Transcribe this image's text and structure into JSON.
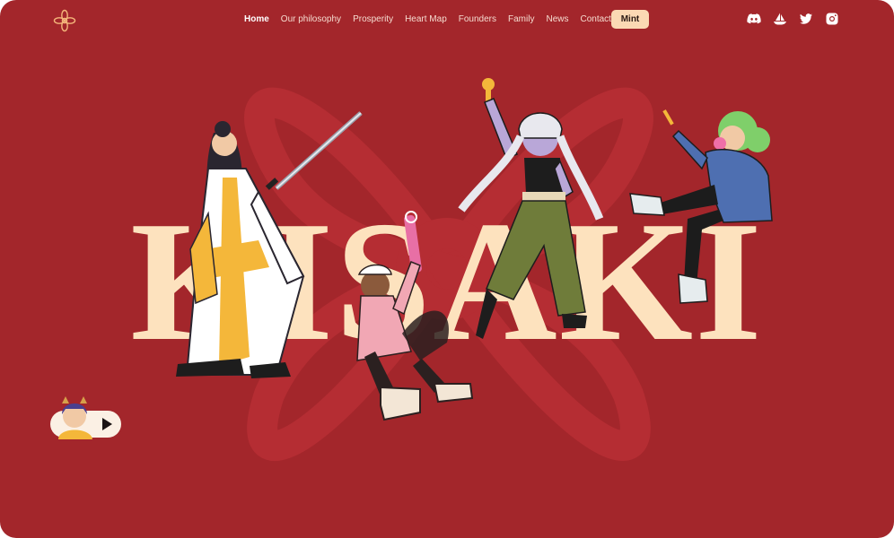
{
  "theme": {
    "background": "#a3262b",
    "watermark": "#b52d33",
    "title_color": "#fde2be",
    "mint_bg": "#fbd9b4",
    "icon_color": "#ffffff"
  },
  "brand": {
    "logo_icon": "flower-knot-logo-icon",
    "hero_title": "KISAKI"
  },
  "nav": {
    "items": [
      {
        "label": "Home",
        "active": true
      },
      {
        "label": "Our philosophy"
      },
      {
        "label": "Prosperity"
      },
      {
        "label": "Heart Map"
      },
      {
        "label": "Founders"
      },
      {
        "label": "Family"
      },
      {
        "label": "News"
      },
      {
        "label": "Contact"
      }
    ],
    "mint_label": "Mint"
  },
  "socials": [
    "discord-icon",
    "opensea-icon",
    "twitter-icon",
    "instagram-icon"
  ],
  "characters": [
    {
      "name": "kimono-samurai-character",
      "palette": [
        "#f4b73a",
        "#ffffff",
        "#2a2630"
      ]
    },
    {
      "name": "pink-streetwear-character",
      "palette": [
        "#f1a7b4",
        "#2b2020",
        "#f3e6d6"
      ]
    },
    {
      "name": "braided-cargo-character",
      "palette": [
        "#6f7c3a",
        "#b9a7d8",
        "#1d1d1d"
      ]
    },
    {
      "name": "green-hair-hoodie-character",
      "palette": [
        "#4e6fb1",
        "#7fcf6a",
        "#1c1c1c"
      ]
    }
  ],
  "player": {
    "play_icon": "play-icon",
    "avatar_icon": "avatar-icon"
  }
}
